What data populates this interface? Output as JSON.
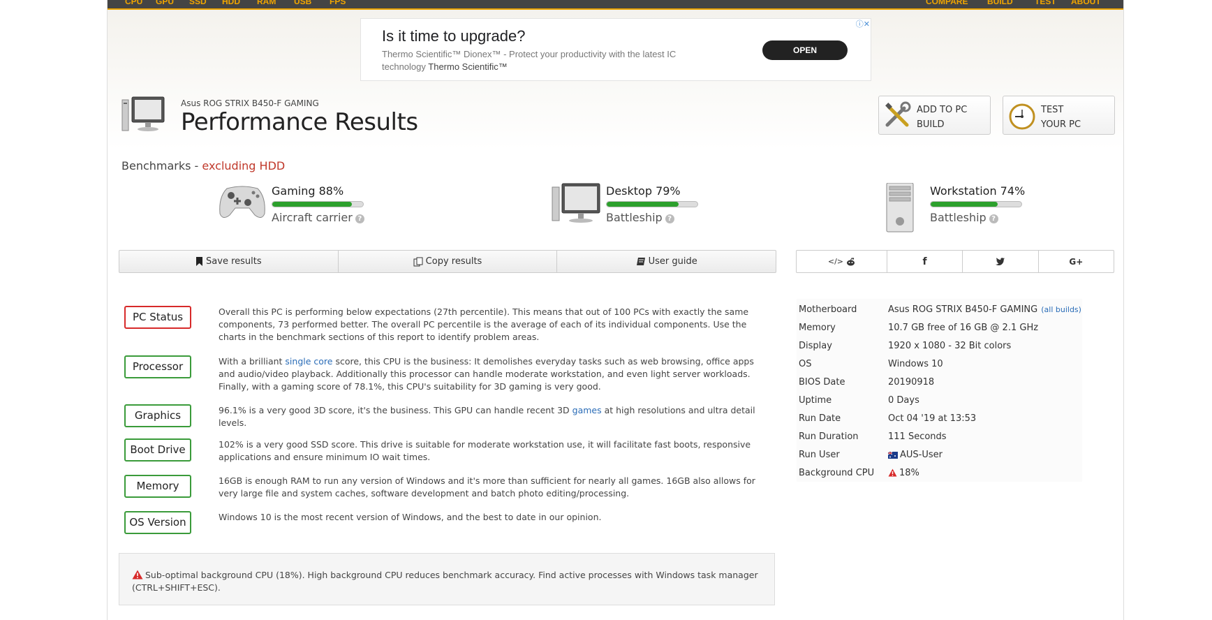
{
  "nav": {
    "left": [
      "CPU",
      "GPU",
      "SSD",
      "HDD",
      "RAM",
      "USB",
      "FPS"
    ],
    "right": [
      "COMPARE",
      "BUILD",
      "TEST",
      "ABOUT"
    ]
  },
  "ad": {
    "title": "Is it time to upgrade?",
    "text": "Thermo Scientific™ Dionex™ - Protect your productivity with the latest IC technology",
    "brand": "Thermo Scientific™",
    "button": "OPEN"
  },
  "header": {
    "subtitle": "Asus ROG STRIX B450-F GAMING",
    "title": "Performance Results",
    "add_line1": "ADD TO PC",
    "add_line2": "BUILD",
    "test_line1": "TEST",
    "test_line2": "YOUR PC"
  },
  "benchmarks": {
    "label": "Benchmarks",
    "sep": " - ",
    "qualifier": "excluding HDD",
    "items": [
      {
        "name": "Gaming 88%",
        "value": 88,
        "rank": "Aircraft carrier"
      },
      {
        "name": "Desktop 79%",
        "value": 79,
        "rank": "Battleship"
      },
      {
        "name": "Workstation 74%",
        "value": 74,
        "rank": "Battleship"
      }
    ]
  },
  "actions": {
    "save": "Save results",
    "copy": "Copy results",
    "guide": "User guide"
  },
  "share": {
    "embed": "</>",
    "facebook": "f",
    "google": "G+"
  },
  "status": [
    {
      "label": "PC Status",
      "text": "Overall this PC is performing below expectations (27th percentile). This means that out of 100 PCs with exactly the same components, 73 performed better. The overall PC percentile is the average of each of its individual components. Use the charts in the benchmark sections of this report to identify problem areas."
    },
    {
      "label": "Processor",
      "pre": "With a brilliant ",
      "link": "single core",
      "post": " score, this CPU is the business: It demolishes everyday tasks such as web browsing, office apps and audio/video playback. Additionally this processor can handle moderate workstation, and even light server workloads. Finally, with a gaming score of 78.1%, this CPU's suitability for 3D gaming is very good."
    },
    {
      "label": "Graphics",
      "pre": "96.1% is a very good 3D score, it's the business. This GPU can handle recent 3D ",
      "link": "games",
      "post": " at high resolutions and ultra detail levels."
    },
    {
      "label": "Boot Drive",
      "text": "102% is a very good SSD score. This drive is suitable for moderate workstation use, it will facilitate fast boots, responsive applications and ensure minimum IO wait times."
    },
    {
      "label": "Memory",
      "text": "16GB is enough RAM to run any version of Windows and it's more than sufficient for nearly all games. 16GB also allows for very large file and system caches, software development and batch photo editing/processing."
    },
    {
      "label": "OS Version",
      "text": "Windows 10 is the most recent version of Windows, and the best to date in our opinion."
    }
  ],
  "specs": [
    {
      "key": "Motherboard",
      "value": "Asus ROG STRIX B450-F GAMING",
      "extra": "(all builds)"
    },
    {
      "key": "Memory",
      "value": "10.7 GB free of 16 GB @ 2.1 GHz"
    },
    {
      "key": "Display",
      "value": "1920 x 1080 - 32 Bit colors"
    },
    {
      "key": "OS",
      "value": "Windows 10"
    },
    {
      "key": "BIOS Date",
      "value": "20190918"
    },
    {
      "key": "Uptime",
      "value": "0 Days"
    },
    {
      "key": "Run Date",
      "value": "Oct 04 '19 at 13:53"
    },
    {
      "key": "Run Duration",
      "value": "111 Seconds"
    },
    {
      "key": "Run User",
      "value": "AUS-User"
    },
    {
      "key": "Background CPU",
      "value": "18%"
    }
  ],
  "warning": {
    "text": "Sub-optimal background CPU (18%). High background CPU reduces benchmark accuracy. Find active processes with Windows task manager (CTRL+SHIFT+ESC)."
  },
  "colors": {
    "accent": "#f0a500",
    "good": "#3a9b3a",
    "bad": "#d72a2a",
    "link": "#2a6cb7"
  }
}
